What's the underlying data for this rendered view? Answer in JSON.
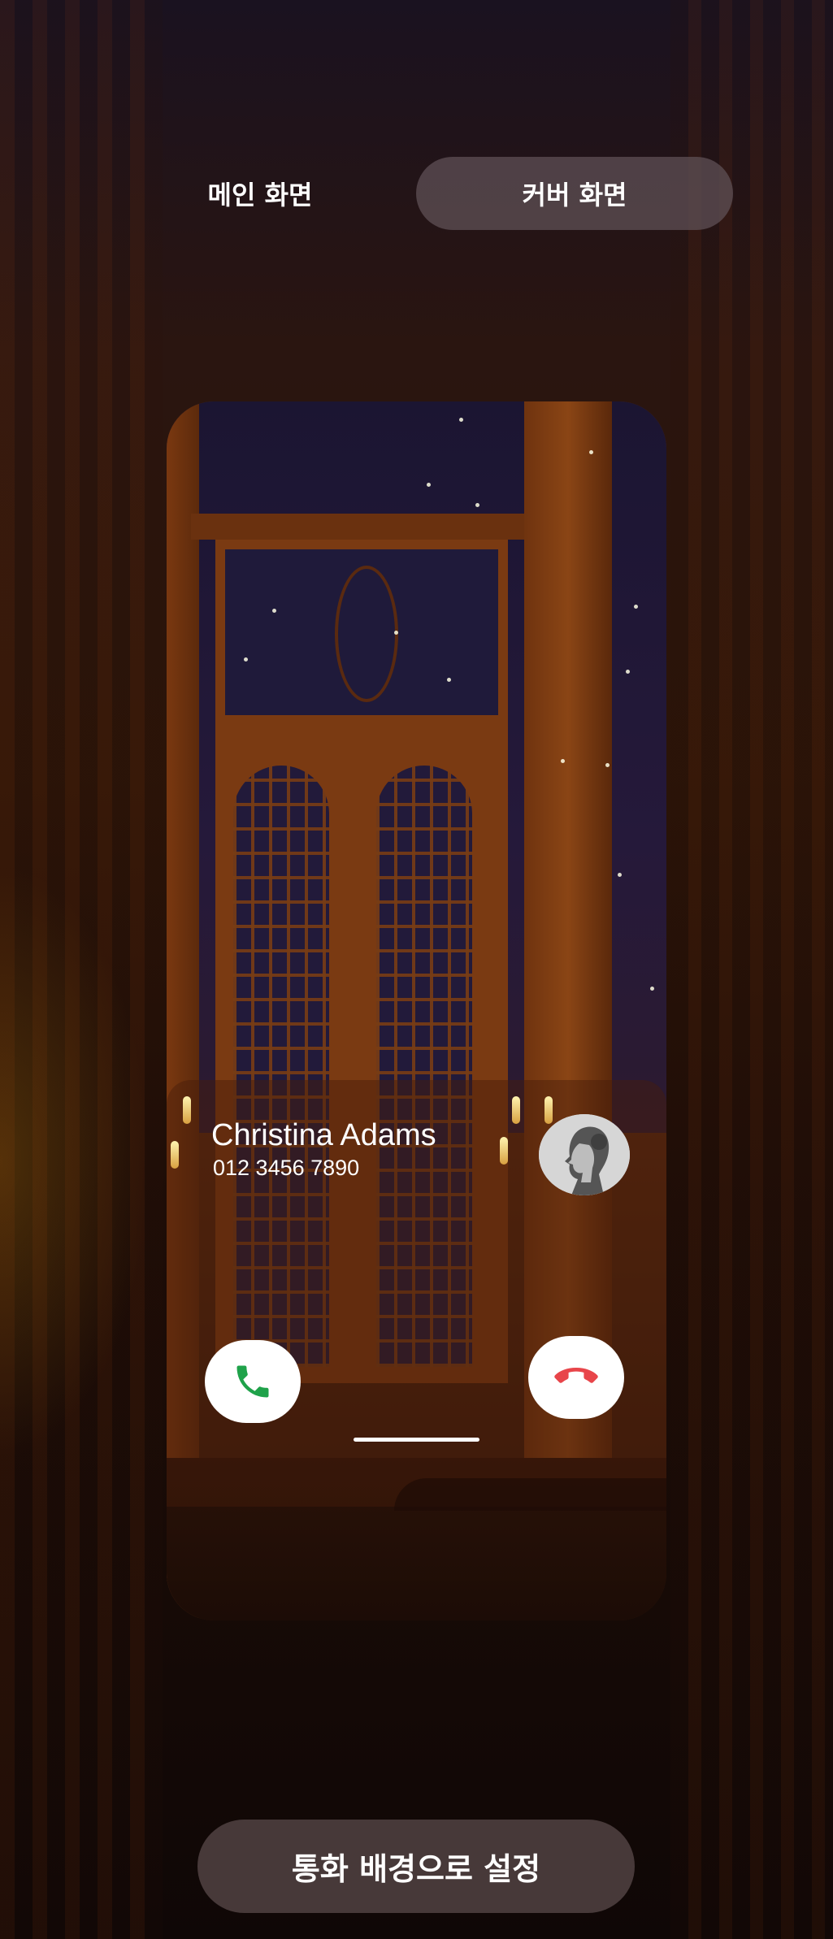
{
  "tabs": {
    "main_label": "메인 화면",
    "cover_label": "커버 화면",
    "selected": "cover"
  },
  "call": {
    "caller_name": "Christina Adams",
    "caller_number": "012 3456 7890"
  },
  "icons": {
    "accept": "phone-icon",
    "decline": "phone-hangup-icon",
    "avatar": "contact-photo"
  },
  "colors": {
    "accept": "#1fa24a",
    "decline": "#e8454a",
    "tab_selected_bg": "#5f5055",
    "button_bg": "#554646"
  },
  "actions": {
    "set_background_label": "통화 배경으로 설정"
  }
}
